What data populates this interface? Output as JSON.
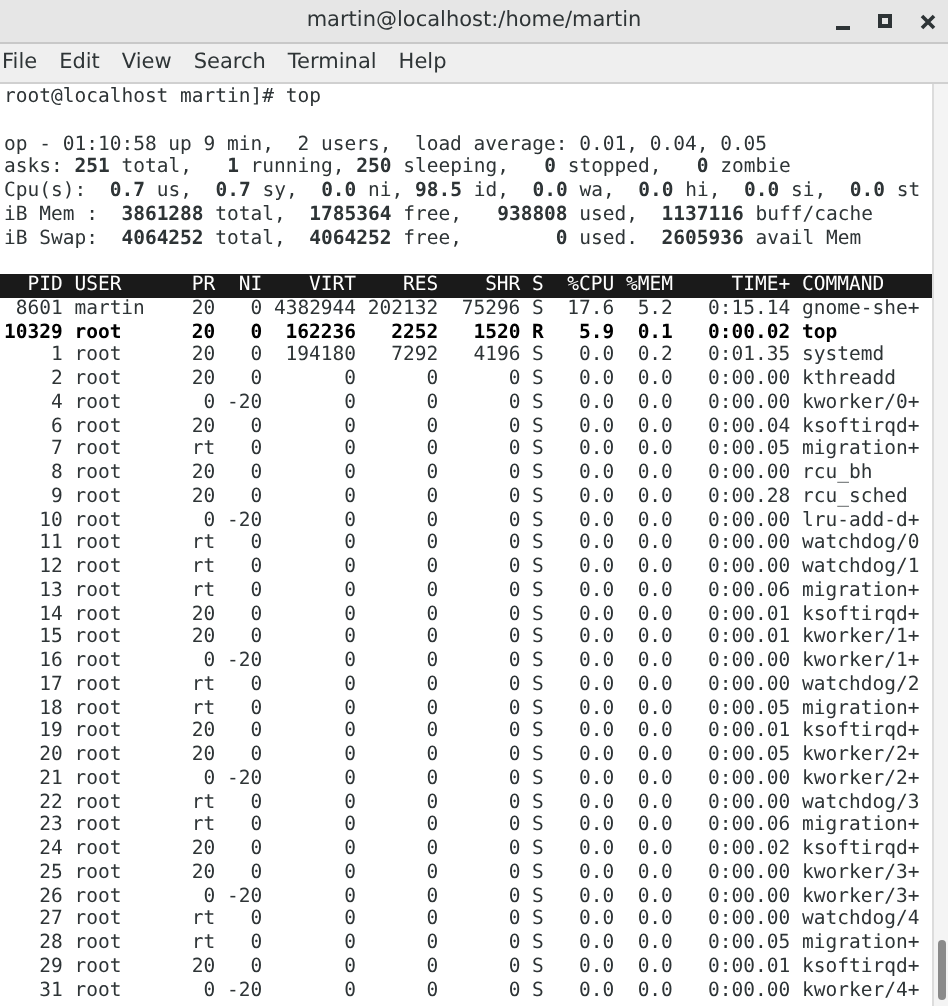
{
  "window": {
    "title": "martin@localhost:/home/martin"
  },
  "menu": [
    "File",
    "Edit",
    "View",
    "Search",
    "Terminal",
    "Help"
  ],
  "terminal": {
    "prompt": "root@localhost martin]# top",
    "summary": [
      "op - 01:10:58 up 9 min,  2 users,  load average: 0.01, 0.04, 0.05",
      "asks: **251** total,   **1** running, **250** sleeping,   **0** stopped,   **0** zombie",
      "Cpu(s):  **0.7** us,  **0.7** sy,  **0.0** ni, **98.5** id,  **0.0** wa,  **0.0** hi,  **0.0** si,  **0.0** st",
      "iB Mem :  **3861288** total,  **1785364** free,   **938808** used,  **1137116** buff/cache",
      "iB Swap:  **4064252** total,  **4064252** free,        **0** used.  **2605936** avail Mem"
    ],
    "table": {
      "columns": [
        "PID",
        "USER",
        "PR",
        "NI",
        "VIRT",
        "RES",
        "SHR",
        "S",
        "%CPU",
        "%MEM",
        "TIME+",
        "COMMAND"
      ],
      "rows": [
        {
          "bold": false,
          "cells": [
            "8601",
            "martin",
            "20",
            "0",
            "4382944",
            "202132",
            "75296",
            "S",
            "17.6",
            "5.2",
            "0:15.14",
            "gnome-she+"
          ]
        },
        {
          "bold": true,
          "cells": [
            "10329",
            "root",
            "20",
            "0",
            "162236",
            "2252",
            "1520",
            "R",
            "5.9",
            "0.1",
            "0:00.02",
            "top"
          ]
        },
        {
          "bold": false,
          "cells": [
            "1",
            "root",
            "20",
            "0",
            "194180",
            "7292",
            "4196",
            "S",
            "0.0",
            "0.2",
            "0:01.35",
            "systemd"
          ]
        },
        {
          "bold": false,
          "cells": [
            "2",
            "root",
            "20",
            "0",
            "0",
            "0",
            "0",
            "S",
            "0.0",
            "0.0",
            "0:00.00",
            "kthreadd"
          ]
        },
        {
          "bold": false,
          "cells": [
            "4",
            "root",
            "0",
            "-20",
            "0",
            "0",
            "0",
            "S",
            "0.0",
            "0.0",
            "0:00.00",
            "kworker/0+"
          ]
        },
        {
          "bold": false,
          "cells": [
            "6",
            "root",
            "20",
            "0",
            "0",
            "0",
            "0",
            "S",
            "0.0",
            "0.0",
            "0:00.04",
            "ksoftirqd+"
          ]
        },
        {
          "bold": false,
          "cells": [
            "7",
            "root",
            "rt",
            "0",
            "0",
            "0",
            "0",
            "S",
            "0.0",
            "0.0",
            "0:00.05",
            "migration+"
          ]
        },
        {
          "bold": false,
          "cells": [
            "8",
            "root",
            "20",
            "0",
            "0",
            "0",
            "0",
            "S",
            "0.0",
            "0.0",
            "0:00.00",
            "rcu_bh"
          ]
        },
        {
          "bold": false,
          "cells": [
            "9",
            "root",
            "20",
            "0",
            "0",
            "0",
            "0",
            "S",
            "0.0",
            "0.0",
            "0:00.28",
            "rcu_sched"
          ]
        },
        {
          "bold": false,
          "cells": [
            "10",
            "root",
            "0",
            "-20",
            "0",
            "0",
            "0",
            "S",
            "0.0",
            "0.0",
            "0:00.00",
            "lru-add-d+"
          ]
        },
        {
          "bold": false,
          "cells": [
            "11",
            "root",
            "rt",
            "0",
            "0",
            "0",
            "0",
            "S",
            "0.0",
            "0.0",
            "0:00.00",
            "watchdog/0"
          ]
        },
        {
          "bold": false,
          "cells": [
            "12",
            "root",
            "rt",
            "0",
            "0",
            "0",
            "0",
            "S",
            "0.0",
            "0.0",
            "0:00.00",
            "watchdog/1"
          ]
        },
        {
          "bold": false,
          "cells": [
            "13",
            "root",
            "rt",
            "0",
            "0",
            "0",
            "0",
            "S",
            "0.0",
            "0.0",
            "0:00.06",
            "migration+"
          ]
        },
        {
          "bold": false,
          "cells": [
            "14",
            "root",
            "20",
            "0",
            "0",
            "0",
            "0",
            "S",
            "0.0",
            "0.0",
            "0:00.01",
            "ksoftirqd+"
          ]
        },
        {
          "bold": false,
          "cells": [
            "15",
            "root",
            "20",
            "0",
            "0",
            "0",
            "0",
            "S",
            "0.0",
            "0.0",
            "0:00.01",
            "kworker/1+"
          ]
        },
        {
          "bold": false,
          "cells": [
            "16",
            "root",
            "0",
            "-20",
            "0",
            "0",
            "0",
            "S",
            "0.0",
            "0.0",
            "0:00.00",
            "kworker/1+"
          ]
        },
        {
          "bold": false,
          "cells": [
            "17",
            "root",
            "rt",
            "0",
            "0",
            "0",
            "0",
            "S",
            "0.0",
            "0.0",
            "0:00.00",
            "watchdog/2"
          ]
        },
        {
          "bold": false,
          "cells": [
            "18",
            "root",
            "rt",
            "0",
            "0",
            "0",
            "0",
            "S",
            "0.0",
            "0.0",
            "0:00.05",
            "migration+"
          ]
        },
        {
          "bold": false,
          "cells": [
            "19",
            "root",
            "20",
            "0",
            "0",
            "0",
            "0",
            "S",
            "0.0",
            "0.0",
            "0:00.01",
            "ksoftirqd+"
          ]
        },
        {
          "bold": false,
          "cells": [
            "20",
            "root",
            "20",
            "0",
            "0",
            "0",
            "0",
            "S",
            "0.0",
            "0.0",
            "0:00.05",
            "kworker/2+"
          ]
        },
        {
          "bold": false,
          "cells": [
            "21",
            "root",
            "0",
            "-20",
            "0",
            "0",
            "0",
            "S",
            "0.0",
            "0.0",
            "0:00.00",
            "kworker/2+"
          ]
        },
        {
          "bold": false,
          "cells": [
            "22",
            "root",
            "rt",
            "0",
            "0",
            "0",
            "0",
            "S",
            "0.0",
            "0.0",
            "0:00.00",
            "watchdog/3"
          ]
        },
        {
          "bold": false,
          "cells": [
            "23",
            "root",
            "rt",
            "0",
            "0",
            "0",
            "0",
            "S",
            "0.0",
            "0.0",
            "0:00.06",
            "migration+"
          ]
        },
        {
          "bold": false,
          "cells": [
            "24",
            "root",
            "20",
            "0",
            "0",
            "0",
            "0",
            "S",
            "0.0",
            "0.0",
            "0:00.02",
            "ksoftirqd+"
          ]
        },
        {
          "bold": false,
          "cells": [
            "25",
            "root",
            "20",
            "0",
            "0",
            "0",
            "0",
            "S",
            "0.0",
            "0.0",
            "0:00.00",
            "kworker/3+"
          ]
        },
        {
          "bold": false,
          "cells": [
            "26",
            "root",
            "0",
            "-20",
            "0",
            "0",
            "0",
            "S",
            "0.0",
            "0.0",
            "0:00.00",
            "kworker/3+"
          ]
        },
        {
          "bold": false,
          "cells": [
            "27",
            "root",
            "rt",
            "0",
            "0",
            "0",
            "0",
            "S",
            "0.0",
            "0.0",
            "0:00.00",
            "watchdog/4"
          ]
        },
        {
          "bold": false,
          "cells": [
            "28",
            "root",
            "rt",
            "0",
            "0",
            "0",
            "0",
            "S",
            "0.0",
            "0.0",
            "0:00.05",
            "migration+"
          ]
        },
        {
          "bold": false,
          "cells": [
            "29",
            "root",
            "20",
            "0",
            "0",
            "0",
            "0",
            "S",
            "0.0",
            "0.0",
            "0:00.01",
            "ksoftirqd+"
          ]
        },
        {
          "bold": false,
          "cells": [
            "31",
            "root",
            "0",
            "-20",
            "0",
            "0",
            "0",
            "S",
            "0.0",
            "0.0",
            "0:00.00",
            "kworker/4+"
          ]
        }
      ]
    }
  }
}
